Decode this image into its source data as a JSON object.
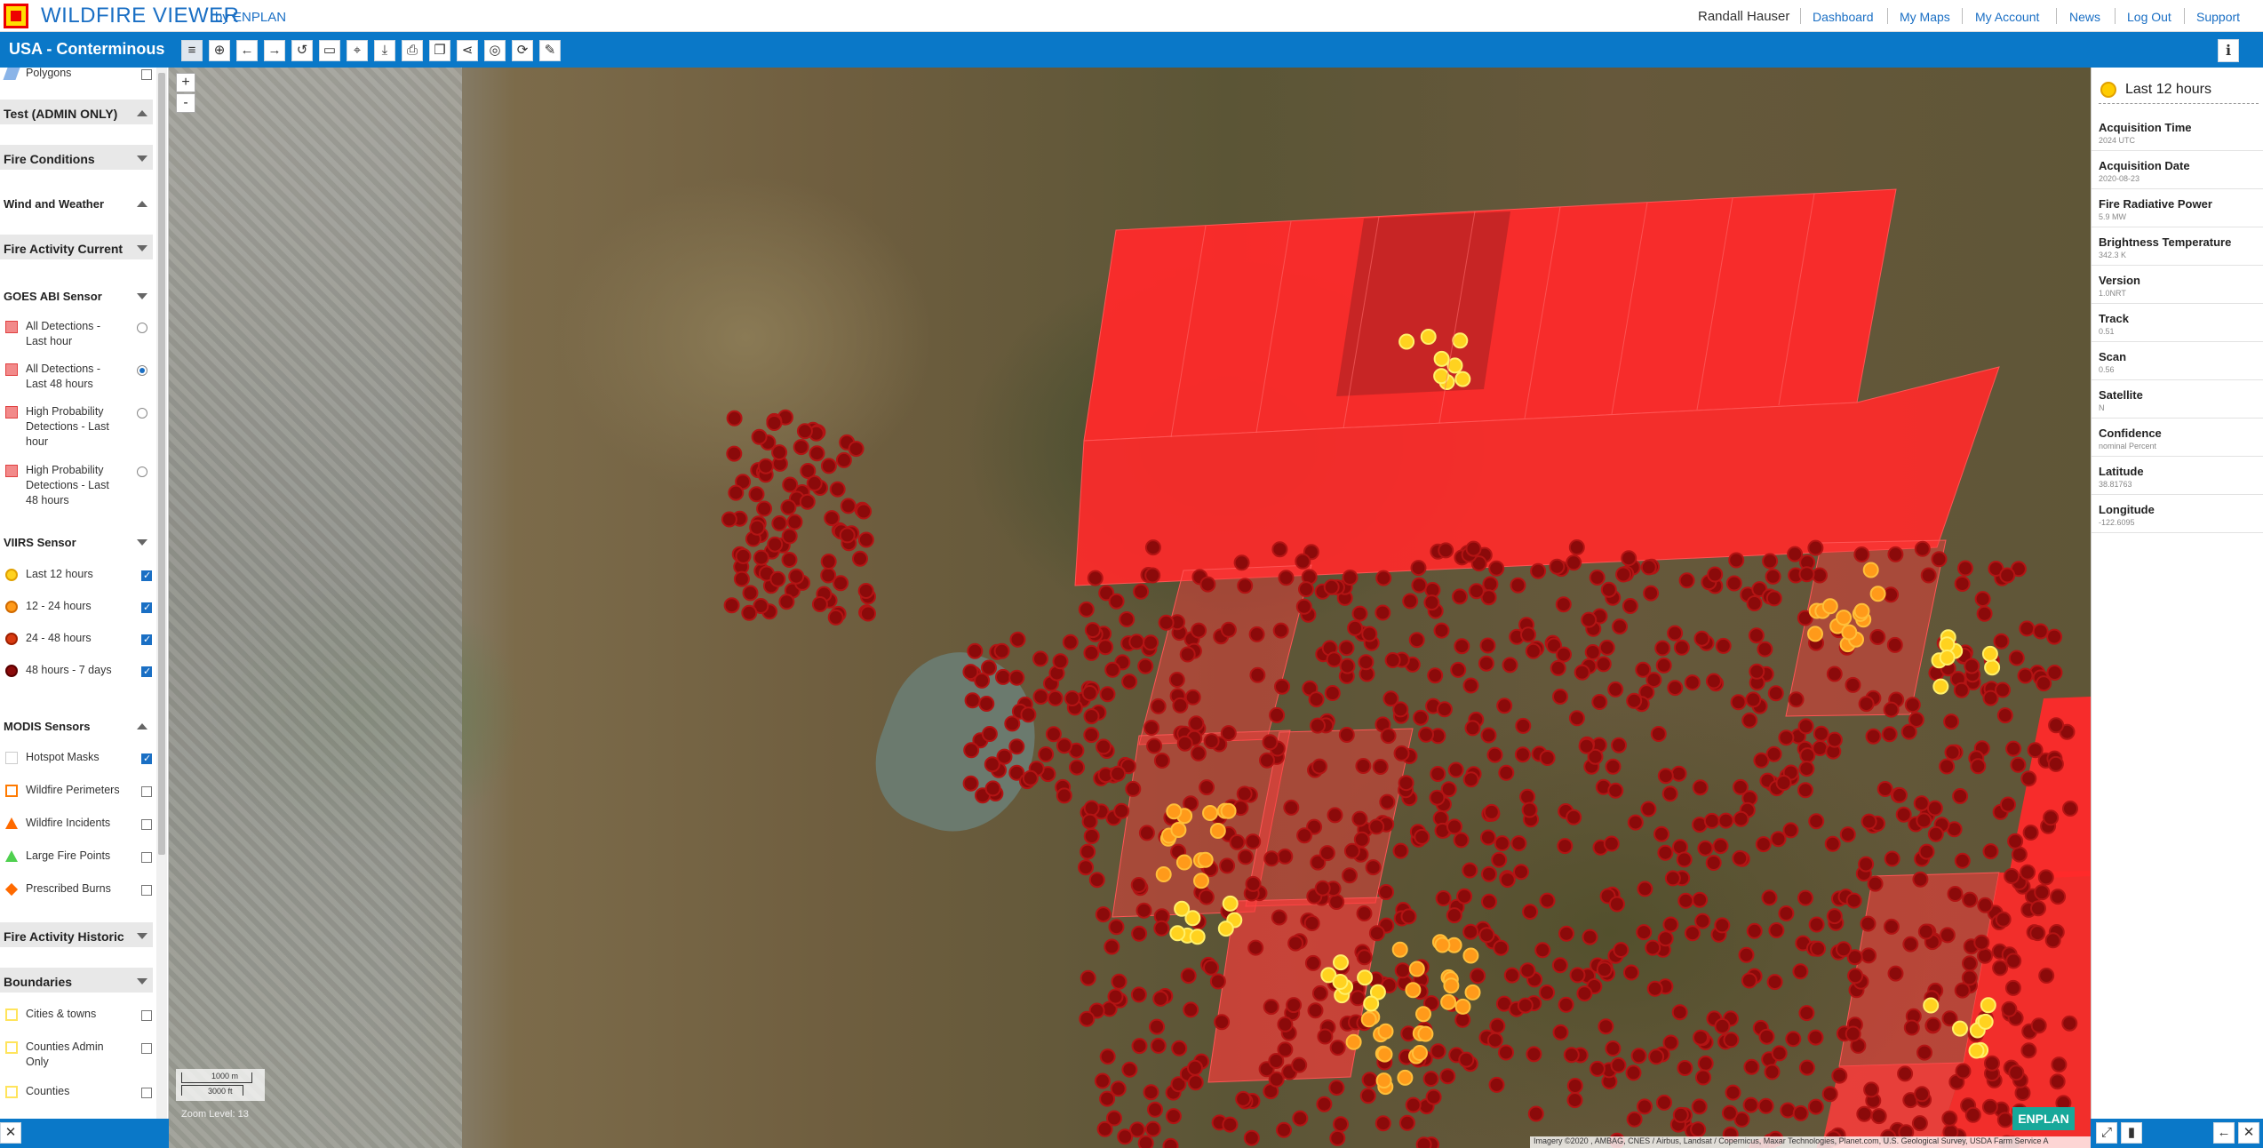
{
  "header": {
    "title": "WILDFIRE VIEWER",
    "by": "by ENPLAN",
    "user": "Randall Hauser",
    "nav": [
      "Dashboard",
      "My Maps",
      "My Account",
      "News",
      "Log Out",
      "Support"
    ]
  },
  "toolbar": {
    "region": "USA - Conterminous",
    "tools": [
      "layers-icon",
      "new-map-icon",
      "back-icon",
      "forward-icon",
      "refresh-icon",
      "measure-icon",
      "select-icon",
      "download-icon",
      "print-icon",
      "bookmark-icon",
      "share-icon",
      "locate-icon",
      "reload-icon",
      "edit-icon"
    ],
    "info_icon": "info-icon"
  },
  "left_panel": {
    "partial_item": "Polygons",
    "sections": {
      "test_admin": "Test (ADMIN ONLY)",
      "fire_conditions": "Fire Conditions",
      "wind_weather": "Wind and Weather",
      "fire_activity_current": "Fire Activity Current",
      "fire_activity_historic": "Fire Activity Historic",
      "boundaries": "Boundaries"
    },
    "goes": {
      "title": "GOES ABI Sensor",
      "items": [
        {
          "label": "All Detections - Last hour",
          "selected": false
        },
        {
          "label": "All Detections - Last 48 hours",
          "selected": true
        },
        {
          "label": "High Probability Detections - Last hour",
          "selected": false
        },
        {
          "label": "High Probability Detections - Last 48 hours",
          "selected": false
        }
      ]
    },
    "viirs": {
      "title": "VIIRS Sensor",
      "items": [
        {
          "label": "Last 12 hours",
          "checked": true,
          "color": "#ffd21f"
        },
        {
          "label": "12 - 24 hours",
          "checked": true,
          "color": "#ff9a1a"
        },
        {
          "label": "24 - 48 hours",
          "checked": true,
          "color": "#d83a10"
        },
        {
          "label": "48 hours - 7 days",
          "checked": true,
          "color": "#8b0a0a"
        }
      ]
    },
    "modis": {
      "title": "MODIS Sensors",
      "items": [
        {
          "label": "Hotspot Masks",
          "checked": true
        },
        {
          "label": "Wildfire Perimeters",
          "checked": false
        },
        {
          "label": "Wildfire Incidents",
          "checked": false
        },
        {
          "label": "Large Fire Points",
          "checked": false
        },
        {
          "label": "Prescribed Burns",
          "checked": false
        }
      ]
    },
    "boundaries": [
      {
        "label": "Cities & towns",
        "checked": false
      },
      {
        "label": "Counties Admin Only",
        "checked": false
      },
      {
        "label": "Counties",
        "checked": false
      }
    ]
  },
  "map": {
    "zoom_in": "+",
    "zoom_out": "-",
    "scale_m": "1000 m",
    "scale_ft": "3000 ft",
    "zoom_level": "Zoom Level: 13",
    "attribution": "Imagery ©2020 , AMBAG, CNES / Airbus, Landsat / Copernicus, Maxar Technologies, Planet.com, U.S. Geological Survey, USDA Farm Service A",
    "badge": "ENPLAN"
  },
  "right_panel": {
    "title": "Last 12 hours",
    "fields": [
      {
        "name": "Acquisition Time",
        "value": "2024 UTC"
      },
      {
        "name": "Acquisition Date",
        "value": "2020-08-23"
      },
      {
        "name": "Fire Radiative Power",
        "value": "5.9 MW"
      },
      {
        "name": "Brightness Temperature",
        "value": "342.3 K"
      },
      {
        "name": "Version",
        "value": "1.0NRT"
      },
      {
        "name": "Track",
        "value": "0.51"
      },
      {
        "name": "Scan",
        "value": "0.56"
      },
      {
        "name": "Satellite",
        "value": "N"
      },
      {
        "name": "Confidence",
        "value": "nominal Percent"
      },
      {
        "name": "Latitude",
        "value": "38.81763"
      },
      {
        "name": "Longitude",
        "value": "-122.6095"
      }
    ]
  },
  "bottom": {
    "close_icon": "close-icon",
    "right_icons": [
      "expand-icon",
      "chart-icon",
      "back-icon",
      "close-icon"
    ]
  }
}
